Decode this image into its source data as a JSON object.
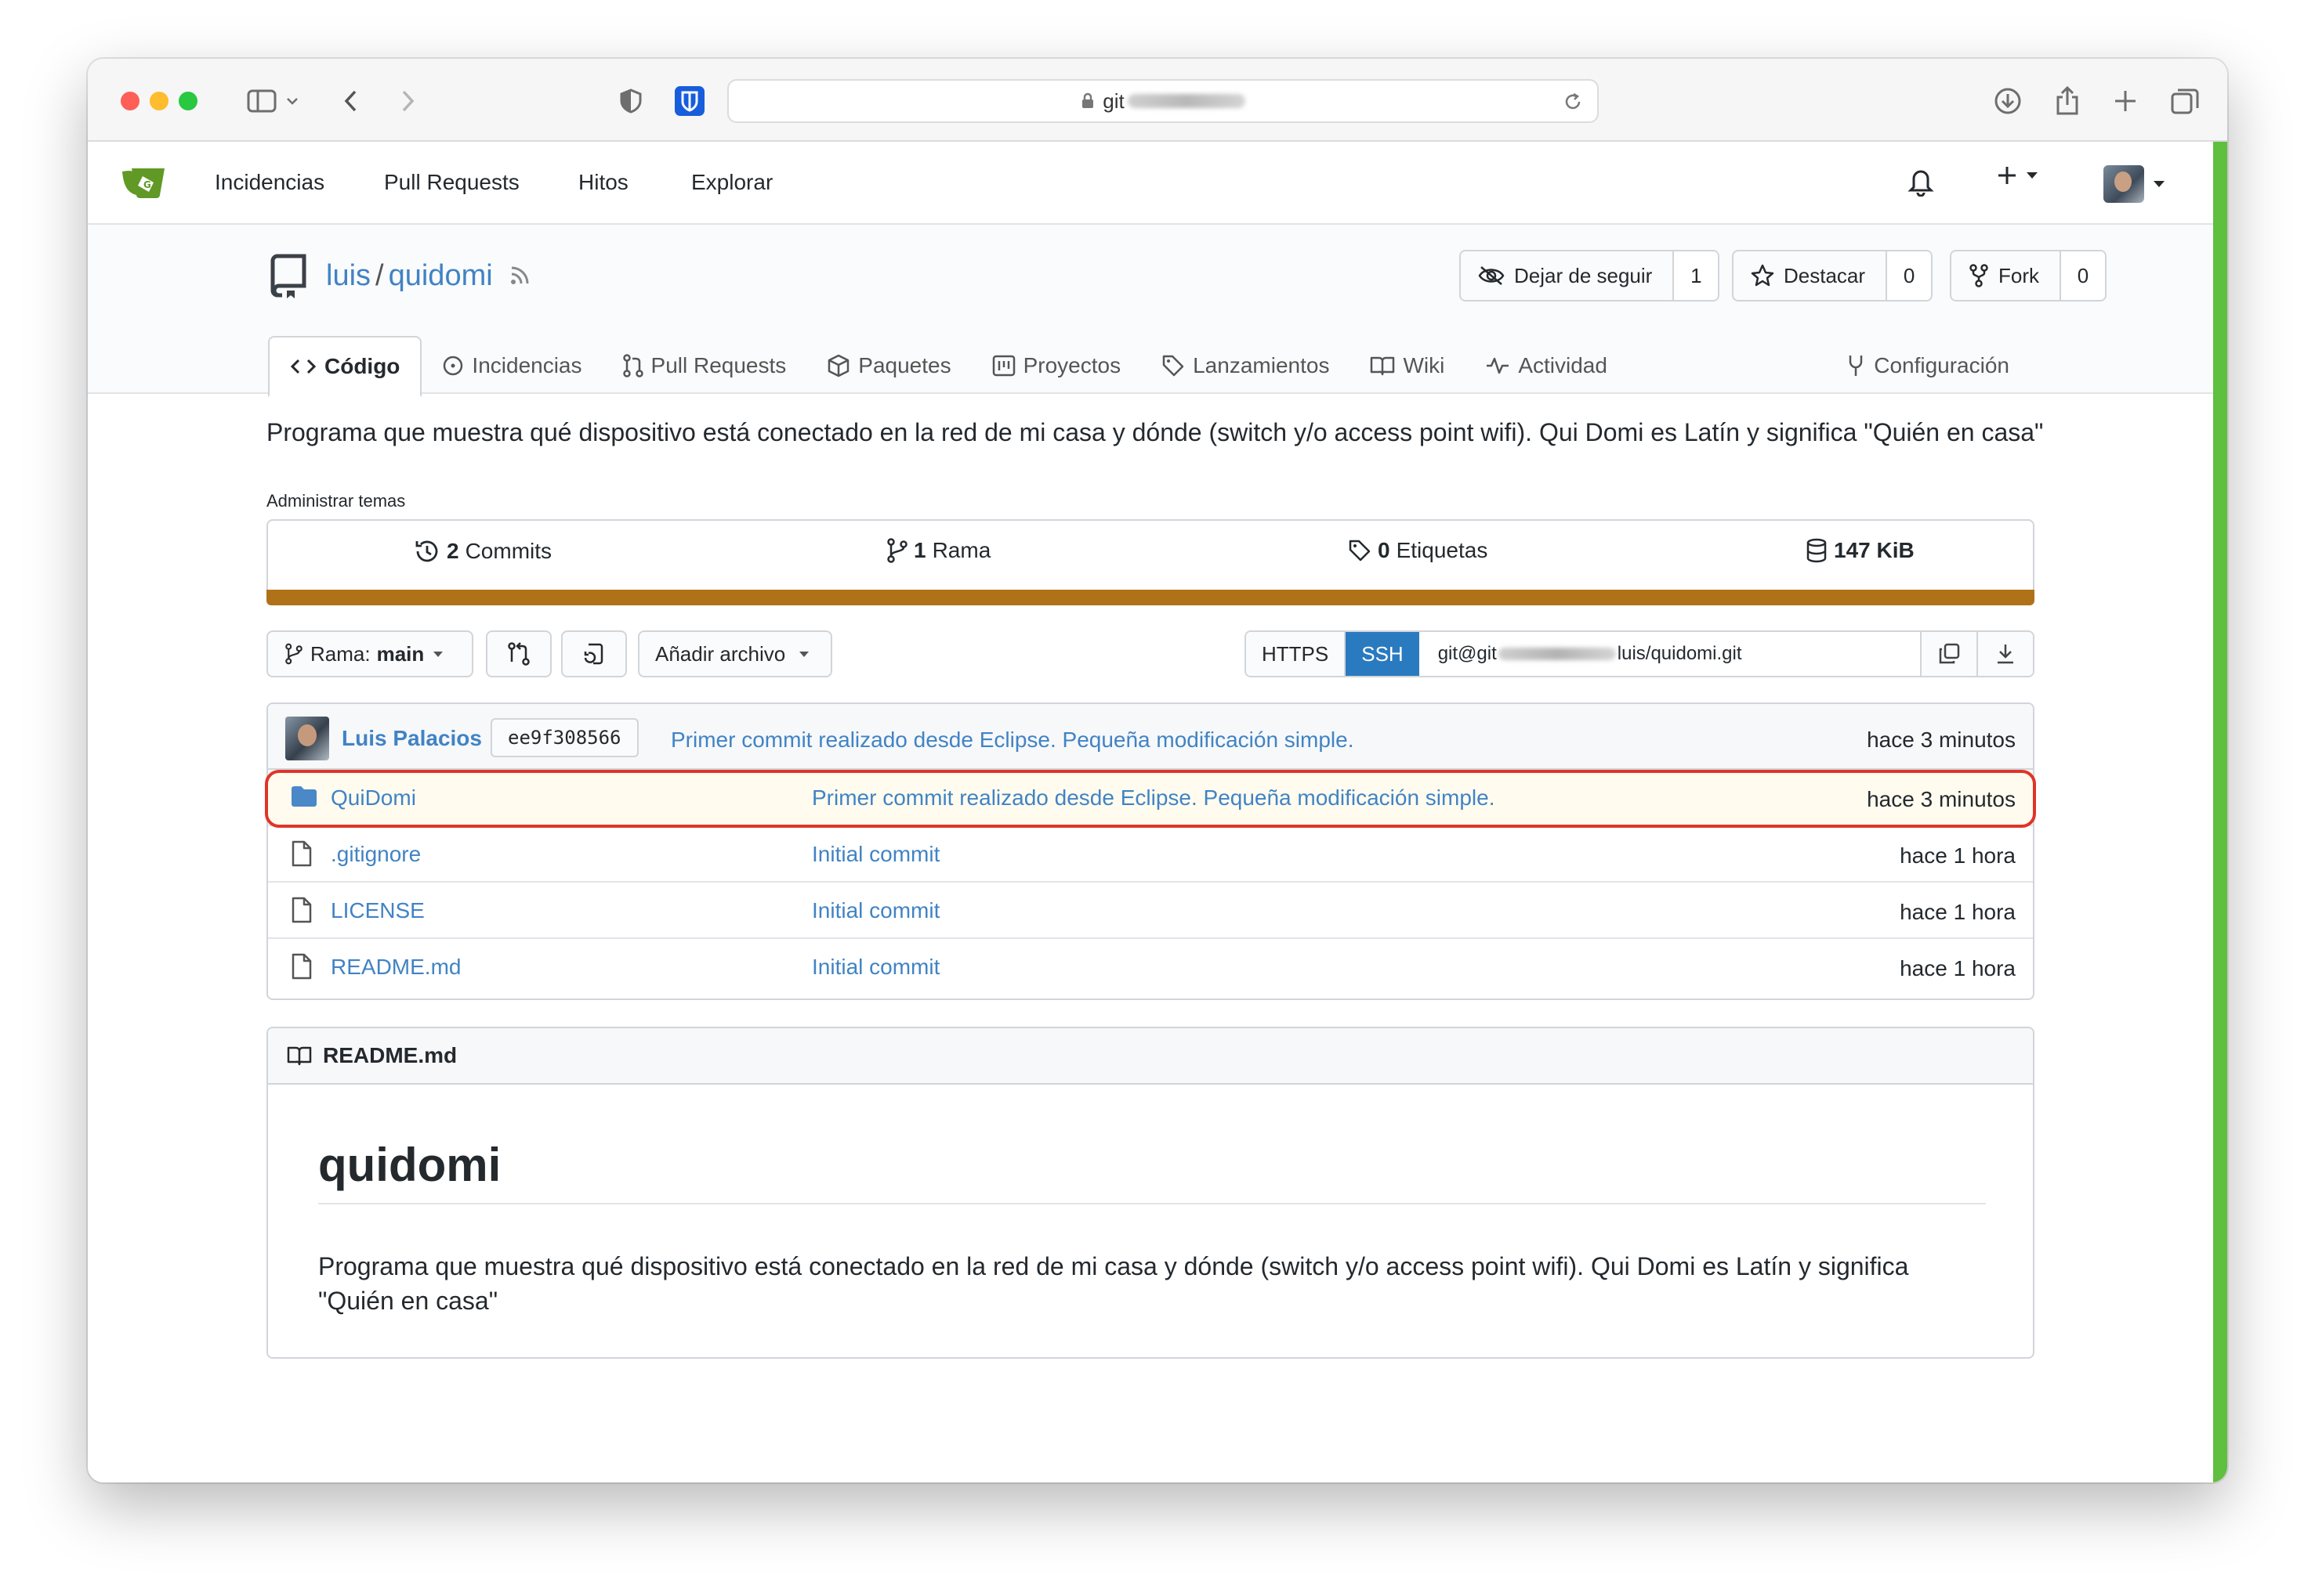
{
  "browser": {
    "address": "git",
    "icons": [
      "sidebar-icon",
      "chevron-down-icon",
      "back-icon",
      "forward-icon",
      "shield-icon",
      "bitwarden-icon",
      "lock-icon",
      "reload-icon",
      "download-icon",
      "share-icon",
      "plus-icon",
      "tabs-icon"
    ]
  },
  "nav": {
    "links": [
      "Incidencias",
      "Pull Requests",
      "Hitos",
      "Explorar"
    ]
  },
  "repo": {
    "owner": "luis",
    "separator": "/",
    "name": "quidomi",
    "watch": {
      "label": "Dejar de seguir",
      "count": "1"
    },
    "star": {
      "label": "Destacar",
      "count": "0"
    },
    "fork": {
      "label": "Fork",
      "count": "0"
    },
    "tabs": {
      "code": "Código",
      "issues": "Incidencias",
      "pulls": "Pull Requests",
      "packages": "Paquetes",
      "projects": "Proyectos",
      "releases": "Lanzamientos",
      "wiki": "Wiki",
      "activity": "Actividad",
      "settings": "Configuración"
    },
    "description": "Programa que muestra qué dispositivo está conectado en la red de mi casa y dónde (switch y/o access point wifi). Qui Domi es Latín y significa \"Quién en casa\"",
    "manage_topics": "Administrar temas",
    "stats": {
      "commits_num": "2",
      "commits_label": "Commits",
      "branches_num": "1",
      "branches_label": "Rama",
      "tags_num": "0",
      "tags_label": "Etiquetas",
      "size": "147 KiB"
    },
    "language_color": "#b07219"
  },
  "controls": {
    "branch_label": "Rama:",
    "branch_value": "main",
    "add_file": "Añadir archivo",
    "https": "HTTPS",
    "ssh": "SSH",
    "clone_url_prefix": "git@git",
    "clone_url_suffix": "luis/quidomi.git"
  },
  "last_commit": {
    "author": "Luis Palacios",
    "sha": "ee9f308566",
    "message": "Primer commit realizado desde Eclipse. Pequeña modificación simple.",
    "time": "hace 3 minutos"
  },
  "files": [
    {
      "name": "QuiDomi",
      "type": "folder",
      "message": "Primer commit realizado desde Eclipse. Pequeña modificación simple.",
      "time": "hace 3 minutos",
      "highlighted": true
    },
    {
      "name": ".gitignore",
      "type": "file",
      "message": "Initial commit",
      "time": "hace 1 hora"
    },
    {
      "name": "LICENSE",
      "type": "file",
      "message": "Initial commit",
      "time": "hace 1 hora"
    },
    {
      "name": "README.md",
      "type": "file",
      "message": "Initial commit",
      "time": "hace 1 hora"
    }
  ],
  "readme": {
    "filename": "README.md",
    "title": "quidomi",
    "body": "Programa que muestra qué dispositivo está conectado en la red de mi casa y dónde (switch y/o access point wifi). Qui Domi es Latín y significa \"Quién en casa\""
  },
  "colors": {
    "link": "#4183c4",
    "ssh_selected": "#2a7ac0",
    "highlight_ring": "#e0342a",
    "logo_green": "#609926"
  }
}
